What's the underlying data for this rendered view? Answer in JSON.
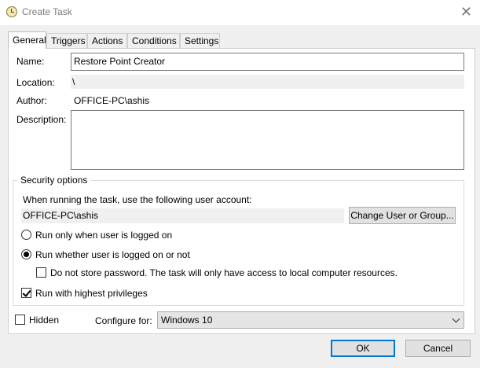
{
  "window": {
    "title": "Create Task",
    "close_glyph": "✕",
    "icon": "task-scheduler-icon"
  },
  "tabs": [
    {
      "label": "General",
      "active": true
    },
    {
      "label": "Triggers",
      "active": false
    },
    {
      "label": "Actions",
      "active": false
    },
    {
      "label": "Conditions",
      "active": false
    },
    {
      "label": "Settings",
      "active": false
    }
  ],
  "general": {
    "name_label": "Name:",
    "name_value": "Restore Point Creator",
    "location_label": "Location:",
    "location_value": "\\",
    "author_label": "Author:",
    "author_value": "OFFICE-PC\\ashis",
    "description_label": "Description:",
    "description_value": ""
  },
  "security": {
    "group_title": "Security options",
    "account_prompt": "When running the task, use the following user account:",
    "account_value": "OFFICE-PC\\ashis",
    "change_user_button": "Change User or Group...",
    "run_logged_on_label": "Run only when user is logged on",
    "run_whether_label": "Run whether user is logged on or not",
    "run_whether_selected": true,
    "no_store_password_label": "Do not store password.  The task will only have access to local computer resources.",
    "no_store_password_checked": false,
    "highest_privileges_label": "Run with highest privileges",
    "highest_privileges_checked": true
  },
  "footer_options": {
    "hidden_label": "Hidden",
    "hidden_checked": false,
    "configure_label": "Configure for:",
    "configure_value": "Windows 10"
  },
  "buttons": {
    "ok": "OK",
    "cancel": "Cancel"
  }
}
